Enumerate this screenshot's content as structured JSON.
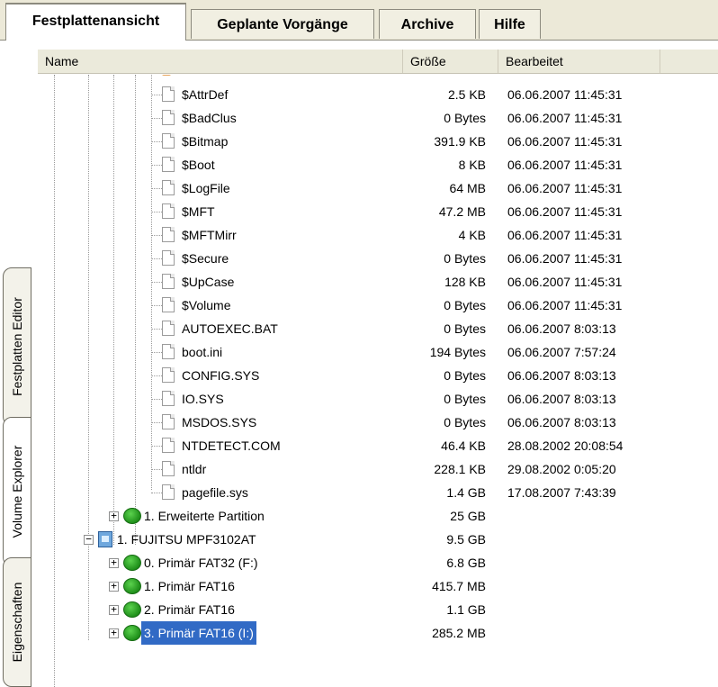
{
  "top_tabs": [
    {
      "label": "Festplattenansicht",
      "active": true
    },
    {
      "label": "Geplante Vorgänge",
      "active": false
    },
    {
      "label": "Archive",
      "active": false
    },
    {
      "label": "Hilfe",
      "active": false
    }
  ],
  "side_tabs": [
    {
      "label": "Festplatten Editor"
    },
    {
      "label": "Volume Explorer"
    },
    {
      "label": "Eigenschaften"
    }
  ],
  "columns": {
    "name": "Name",
    "size": "Größe",
    "modified": "Bearbeitet"
  },
  "rows": [
    {
      "name": "$AttrDef",
      "size": "2.5 KB",
      "modified": "06.06.2007 11:45:31"
    },
    {
      "name": "$BadClus",
      "size": "0 Bytes",
      "modified": "06.06.2007 11:45:31"
    },
    {
      "name": "$Bitmap",
      "size": "391.9 KB",
      "modified": "06.06.2007 11:45:31"
    },
    {
      "name": "$Boot",
      "size": "8 KB",
      "modified": "06.06.2007 11:45:31"
    },
    {
      "name": "$LogFile",
      "size": "64 MB",
      "modified": "06.06.2007 11:45:31"
    },
    {
      "name": "$MFT",
      "size": "47.2 MB",
      "modified": "06.06.2007 11:45:31"
    },
    {
      "name": "$MFTMirr",
      "size": "4 KB",
      "modified": "06.06.2007 11:45:31"
    },
    {
      "name": "$Secure",
      "size": "0 Bytes",
      "modified": "06.06.2007 11:45:31"
    },
    {
      "name": "$UpCase",
      "size": "128 KB",
      "modified": "06.06.2007 11:45:31"
    },
    {
      "name": "$Volume",
      "size": "0 Bytes",
      "modified": "06.06.2007 11:45:31"
    },
    {
      "name": "AUTOEXEC.BAT",
      "size": "0 Bytes",
      "modified": "06.06.2007 8:03:13"
    },
    {
      "name": "boot.ini",
      "size": "194 Bytes",
      "modified": "06.06.2007 7:57:24"
    },
    {
      "name": "CONFIG.SYS",
      "size": "0 Bytes",
      "modified": "06.06.2007 8:03:13"
    },
    {
      "name": "IO.SYS",
      "size": "0 Bytes",
      "modified": "06.06.2007 8:03:13"
    },
    {
      "name": "MSDOS.SYS",
      "size": "0 Bytes",
      "modified": "06.06.2007 8:03:13"
    },
    {
      "name": "NTDETECT.COM",
      "size": "46.4 KB",
      "modified": "28.08.2002 20:08:54"
    },
    {
      "name": "ntldr",
      "size": "228.1 KB",
      "modified": "29.08.2002 0:05:20"
    },
    {
      "name": "pagefile.sys",
      "size": "1.4 GB",
      "modified": "17.08.2007 7:43:39"
    },
    {
      "name": "1. Erweiterte Partition",
      "size": "25 GB",
      "modified": ""
    },
    {
      "name": "1. FUJITSU MPF3102AT",
      "size": "9.5 GB",
      "modified": ""
    },
    {
      "name": "0. Primär FAT32 (F:)",
      "size": "6.8 GB",
      "modified": ""
    },
    {
      "name": "1. Primär FAT16",
      "size": "415.7 MB",
      "modified": ""
    },
    {
      "name": "2. Primär FAT16",
      "size": "1.1 GB",
      "modified": ""
    },
    {
      "name": "3. Primär FAT16 (I:)",
      "size": "285.2 MB",
      "modified": ""
    }
  ]
}
